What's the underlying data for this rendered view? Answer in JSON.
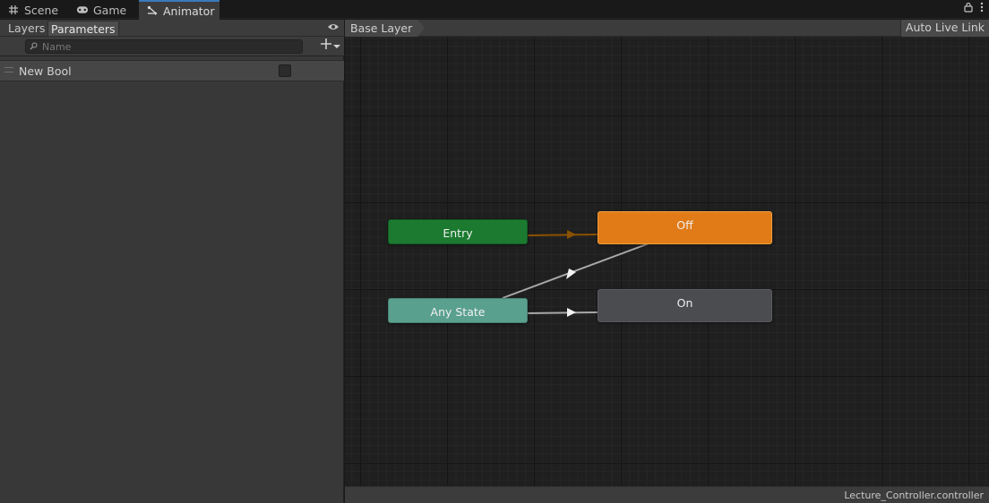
{
  "tabs": [
    {
      "label": "Scene",
      "icon": "grid-icon"
    },
    {
      "label": "Game",
      "icon": "gamepad-icon"
    },
    {
      "label": "Animator",
      "icon": "animator-icon"
    }
  ],
  "left_panel": {
    "subtabs": [
      "Layers",
      "Parameters"
    ],
    "selected_subtab": "Parameters",
    "search_placeholder": "Name",
    "parameters": [
      {
        "name": "New Bool",
        "type": "bool",
        "value": false
      }
    ]
  },
  "graph": {
    "breadcrumb": "Base Layer",
    "live_link_label": "Auto Live Link",
    "footer_file": "Lecture_Controller.controller",
    "states": {
      "entry": "Entry",
      "any_state": "Any State",
      "off": "Off",
      "on": "On"
    }
  },
  "colors": {
    "entry": "#1b7a30",
    "any_state": "#5aa08e",
    "default_state": "#e07b17",
    "state": "#4b4c50",
    "active_tab_accent": "#3a79bb"
  }
}
